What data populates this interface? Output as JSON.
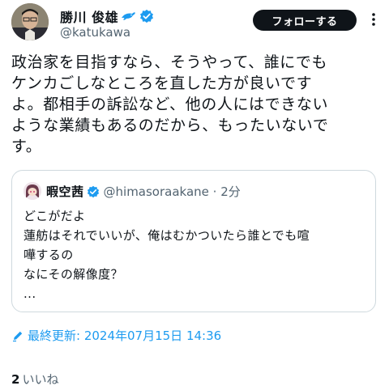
{
  "author": {
    "name": "勝川 俊雄",
    "handle": "@katukawa"
  },
  "follow_button": "フォローする",
  "tweet_text": "政治家を目指すなら、そうやって、誰にでも\nケンカごしなところを直した方が良いです\nよ。都相手の訴訟など、他の人にはできない\nような業績もあるのだから、もったいないで\nす。",
  "quote": {
    "name": "暇空茜",
    "handle_time": "@himasoraakane · 2分",
    "text": "どこがだよ\n蓮舫はそれでいいが、俺はむかついたら誰とでも喧\n嘩するの\nなにその解像度？\n..."
  },
  "updated": "最終更新: 2024年07月15日 14:36",
  "likes": {
    "count": "2",
    "label": "いいね"
  },
  "colors": {
    "accent": "#1d9bf0",
    "text": "#0f1419",
    "secondary": "#536471",
    "button": "#0f1419"
  }
}
